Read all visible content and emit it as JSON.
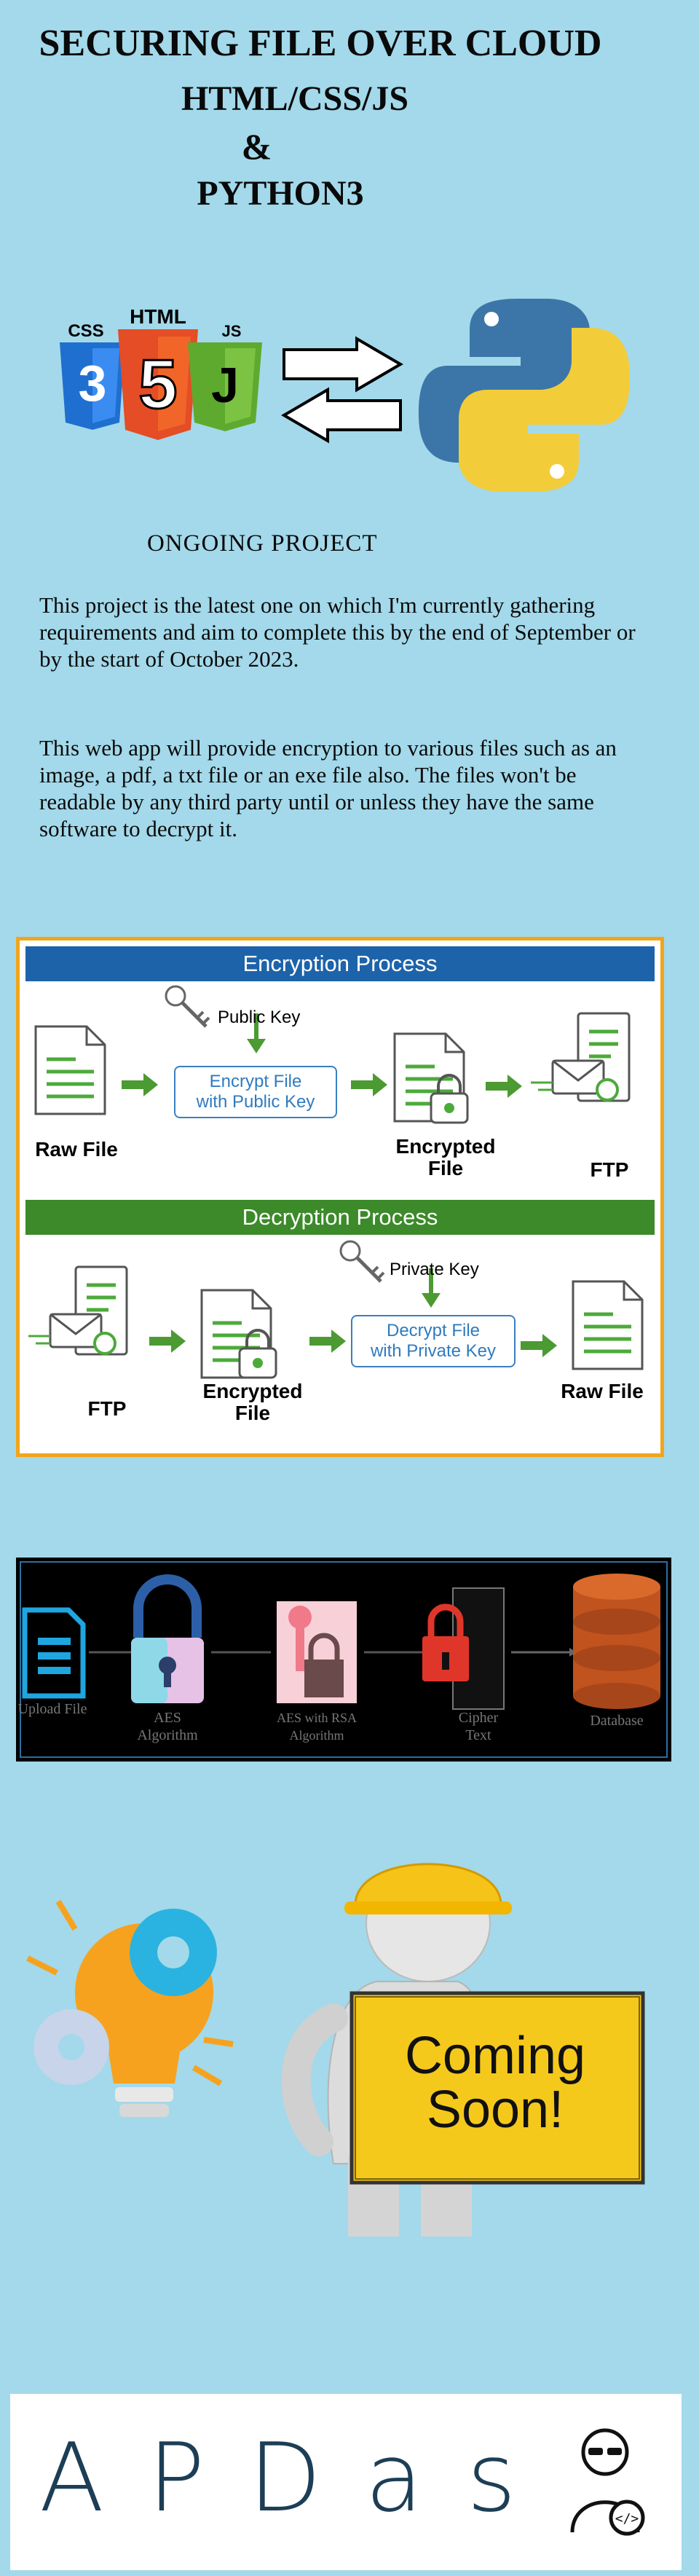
{
  "header": {
    "line1": "SECURING FILE OVER CLOUD",
    "line2": "HTML/CSS/JS",
    "line3": "&",
    "line4": "PYTHON3"
  },
  "tech_logos": {
    "css": "CSS",
    "html": "HTML",
    "js": "JS",
    "five": "5"
  },
  "status": "ONGOING PROJECT",
  "description": {
    "paragraph1": "This project is the latest one on which I'm currently gathering requirements and aim to complete this by the end of September or by the start of October 2023.",
    "paragraph2": "This web app will provide encryption to various files such as an image, a pdf, a txt file or an exe file also. The files won't be readable by any third party until or unless they have the same software to decrypt it."
  },
  "process_diagram": {
    "encryption_title": "Encryption Process",
    "public_key": "Public Key",
    "encrypt_step_line1": "Encrypt File",
    "encrypt_step_line2": "with Public Key",
    "raw_file": "Raw File",
    "encrypted_line1": "Encrypted",
    "encrypted_line2": "File",
    "ftp": "FTP",
    "decryption_title": "Decryption Process",
    "private_key": "Private Key",
    "decrypt_step_line1": "Decrypt File",
    "decrypt_step_line2": "with Private Key",
    "accent_blue": "#1d63a9",
    "accent_green": "#3c8a2a"
  },
  "flow_diagram": {
    "steps": [
      {
        "line1": "Upload File",
        "line2": ""
      },
      {
        "line1": "AES",
        "line2": "Algorithm"
      },
      {
        "line1": "AES with RSA",
        "line2": "Algorithm"
      },
      {
        "line1": "Cipher",
        "line2": "Text"
      },
      {
        "line1": "Database",
        "line2": ""
      }
    ]
  },
  "coming_soon": {
    "line1": "Coming",
    "line2": "Soon!"
  },
  "logo": {
    "letters": "APDas"
  }
}
